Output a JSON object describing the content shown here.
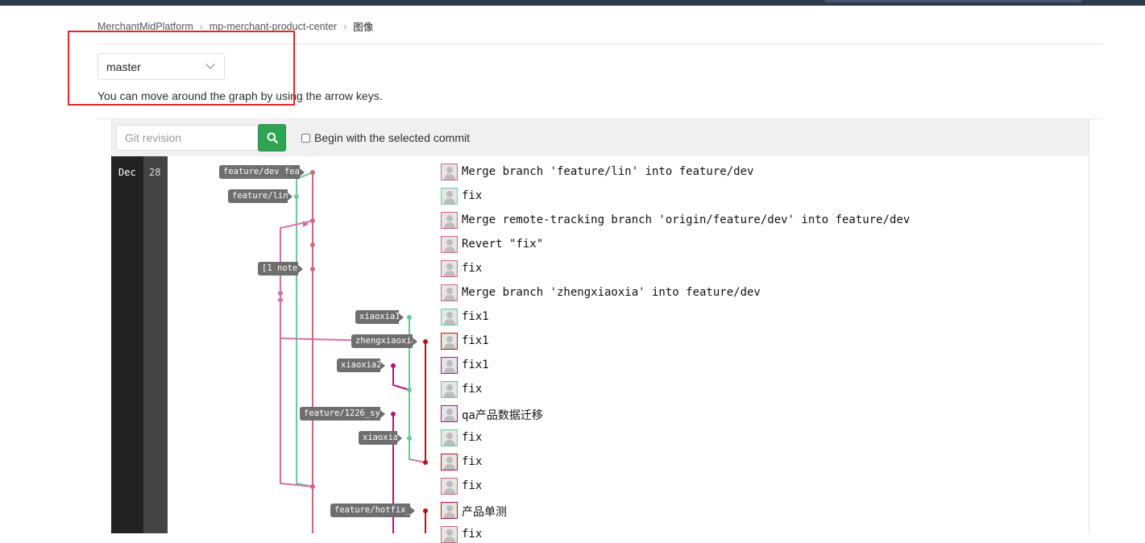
{
  "breadcrumb": {
    "items": [
      "MerchantMidPlatform",
      "mp-merchant-product-center"
    ],
    "current": "图像"
  },
  "branch_select": {
    "value": "master"
  },
  "hint": "You can move around the graph by using the arrow keys.",
  "toolbar": {
    "revision_placeholder": "Git revision",
    "begin_label": "Begin with the selected commit"
  },
  "date": {
    "month": "Dec",
    "day": "28"
  },
  "colors": {
    "brand_green": "#2fa452",
    "highlight_red": "#e0292b",
    "dark_nav": "#2b3a4f"
  },
  "commits": [
    {
      "message": "Merge branch 'feature/lin' into feature/dev",
      "ref": "feature/dev fea…"
    },
    {
      "message": "fix",
      "ref": "feature/lin"
    },
    {
      "message": "Merge remote-tracking branch 'origin/feature/dev' into feature/dev",
      "ref": ""
    },
    {
      "message": "Revert \"fix\"",
      "ref": ""
    },
    {
      "message": "fix",
      "ref": "[1 note]"
    },
    {
      "message": "Merge branch 'zhengxiaoxia' into feature/dev",
      "ref": ""
    },
    {
      "message": "fix1",
      "ref": "xiaoxia1"
    },
    {
      "message": "fix1",
      "ref": "zhengxiaoxia"
    },
    {
      "message": "fix1",
      "ref": "xiaoxia2"
    },
    {
      "message": "fix",
      "ref": ""
    },
    {
      "message": "qa产品数据迁移",
      "ref": "feature/1226_sy…"
    },
    {
      "message": "fix",
      "ref": "xiaoxia"
    },
    {
      "message": "fix",
      "ref": ""
    },
    {
      "message": "fix",
      "ref": ""
    },
    {
      "message": "产品单测",
      "ref": "feature/hotfix_…"
    },
    {
      "message": "fix",
      "ref": ""
    }
  ]
}
